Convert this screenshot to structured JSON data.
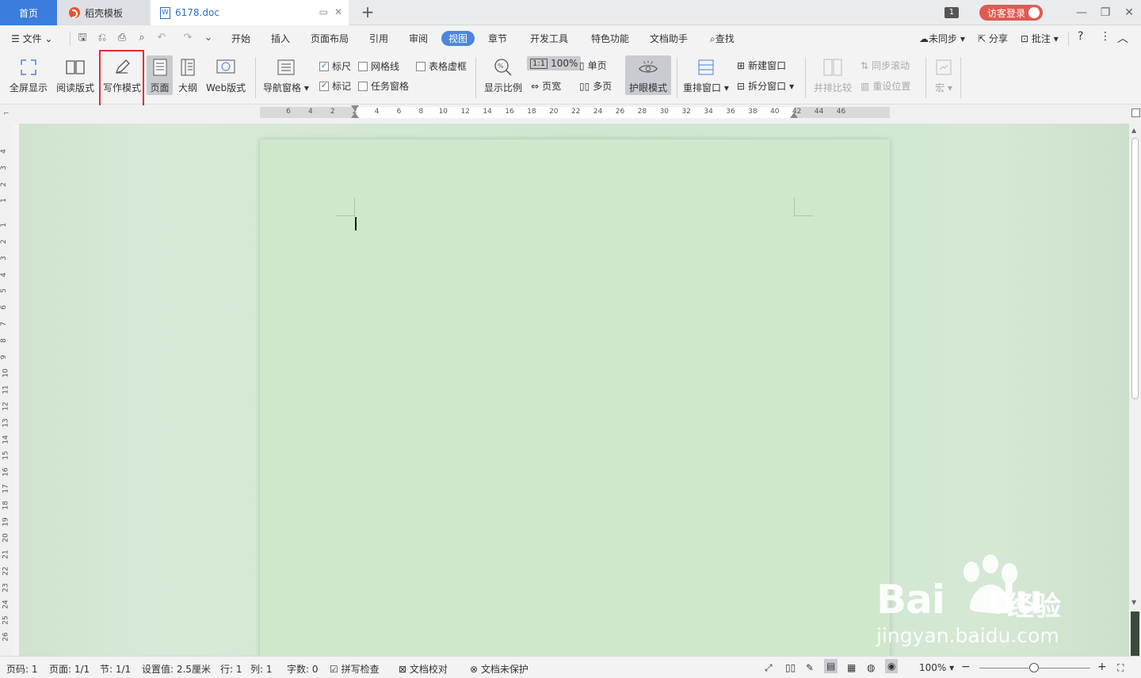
{
  "tabs": {
    "home": "首页",
    "template": "稻壳模板",
    "doc": "6178.doc"
  },
  "title_right": {
    "badge": "1",
    "visitor_login": "访客登录"
  },
  "menu": {
    "file": "文件",
    "items": [
      "开始",
      "插入",
      "页面布局",
      "引用",
      "审阅",
      "视图",
      "章节",
      "开发工具",
      "特色功能",
      "文档助手"
    ],
    "active": "视图",
    "search": "查找",
    "sync": "未同步",
    "share": "分享",
    "comment": "批注"
  },
  "ribbon": {
    "fullscreen": "全屏显示",
    "reading": "阅读版式",
    "writing": "写作模式",
    "page": "页面",
    "outline": "大纲",
    "web": "Web版式",
    "nav_pane": "导航窗格",
    "ruler": "标尺",
    "mark": "标记",
    "gridlines": "网格线",
    "task_pane": "任务窗格",
    "table_border": "表格虚框",
    "zoom": "显示比例",
    "zoom_100": "100%",
    "page_width": "页宽",
    "single_page": "单页",
    "multi_page": "多页",
    "eye_mode": "护眼模式",
    "rearrange": "重排窗口",
    "new_window": "新建窗口",
    "split_window": "拆分窗口",
    "side_by_side": "并排比较",
    "sync_scroll": "同步滚动",
    "reset_pos": "重设位置",
    "macro": "宏"
  },
  "hruler_labels": [
    "6",
    "4",
    "2",
    "2",
    "4",
    "6",
    "8",
    "10",
    "12",
    "14",
    "16",
    "18",
    "20",
    "22",
    "24",
    "26",
    "28",
    "30",
    "32",
    "34",
    "36",
    "38",
    "40",
    "42",
    "44",
    "46"
  ],
  "vruler_labels": [
    "4",
    "3",
    "2",
    "1",
    "1",
    "2",
    "3",
    "4",
    "5",
    "6",
    "7",
    "8",
    "9",
    "10",
    "11",
    "12",
    "13",
    "14",
    "15",
    "16",
    "17",
    "18",
    "19",
    "20",
    "21",
    "22",
    "23",
    "24",
    "25",
    "26"
  ],
  "status": {
    "page_no": "页码: 1",
    "pages": "页面: 1/1",
    "section": "节: 1/1",
    "setting": "设置值: 2.5厘米",
    "row": "行: 1",
    "col": "列: 1",
    "words": "字数: 0",
    "spell": "拼写检查",
    "proof": "文档校对",
    "protect": "文档未保护",
    "zoom": "100%"
  },
  "watermark": {
    "brand": "Bai",
    "brand2": "du",
    "cn": "经验",
    "url": "jingyan.baidu.com"
  }
}
